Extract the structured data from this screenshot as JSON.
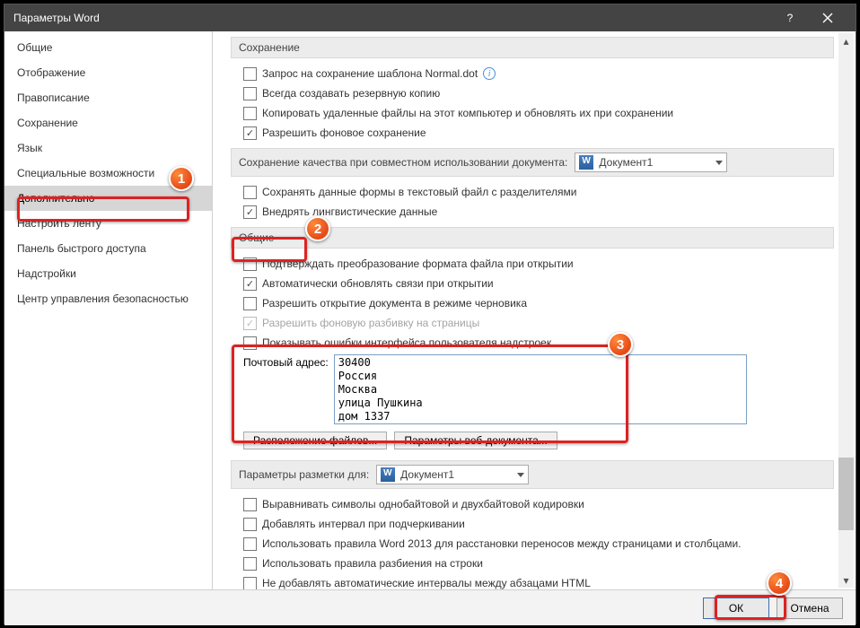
{
  "window": {
    "title": "Параметры Word"
  },
  "sidebar": {
    "items": [
      "Общие",
      "Отображение",
      "Правописание",
      "Сохранение",
      "Язык",
      "Специальные возможности",
      "Дополнительно",
      "Настроить ленту",
      "Панель быстрого доступа",
      "Надстройки",
      "Центр управления безопасностью"
    ],
    "selected_index": 6
  },
  "sections": {
    "saving": {
      "title": "Сохранение",
      "opts": [
        {
          "label": "Запрос на сохранение шаблона Normal.dot",
          "checked": false,
          "info": true
        },
        {
          "label": "Всегда создавать резервную копию",
          "checked": false
        },
        {
          "label": "Копировать удаленные файлы на этот компьютер и обновлять их при сохранении",
          "checked": false
        },
        {
          "label": "Разрешить фоновое сохранение",
          "checked": true
        }
      ]
    },
    "quality": {
      "title": "Сохранение качества при совместном использовании документа:",
      "doc": "Документ1",
      "opts": [
        {
          "label": "Сохранять данные формы в текстовый файл с разделителями",
          "checked": false
        },
        {
          "label": "Внедрять лингвистические данные",
          "checked": true
        }
      ]
    },
    "general": {
      "title": "Общие",
      "opts": [
        {
          "label": "Подтверждать преобразование формата файла при открытии",
          "checked": false
        },
        {
          "label": "Автоматически обновлять связи при открытии",
          "checked": true
        },
        {
          "label": "Разрешить открытие документа в режиме черновика",
          "checked": false
        },
        {
          "label": "Разрешить фоновую разбивку на страницы",
          "checked": true,
          "disabled": true
        },
        {
          "label": "Показывать ошибки интерфейса пользователя надстроек",
          "checked": false
        }
      ],
      "addr_label": "Почтовый адрес:",
      "addr_value": "30400\nРоссия\nМосква\nулица Пушкина\nдом 1337",
      "btn_files": "Расположение файлов...",
      "btn_web": "Параметры веб-документа..."
    },
    "layout": {
      "title": "Параметры разметки для:",
      "doc": "Документ1",
      "opts": [
        {
          "label": "Выравнивать символы однобайтовой и двухбайтовой кодировки",
          "checked": false
        },
        {
          "label": "Добавлять интервал при подчеркивании",
          "checked": false
        },
        {
          "label": "Использовать правила Word 2013 для расстановки переносов между страницами и столбцами.",
          "checked": false
        },
        {
          "label": "Использовать правила разбиения на строки",
          "checked": false
        },
        {
          "label": "Не добавлять автоматические интервалы между абзацами HTML",
          "checked": false
        }
      ]
    }
  },
  "buttons": {
    "ok": "ОК",
    "cancel": "Отмена"
  },
  "callouts": [
    "1",
    "2",
    "3",
    "4"
  ]
}
